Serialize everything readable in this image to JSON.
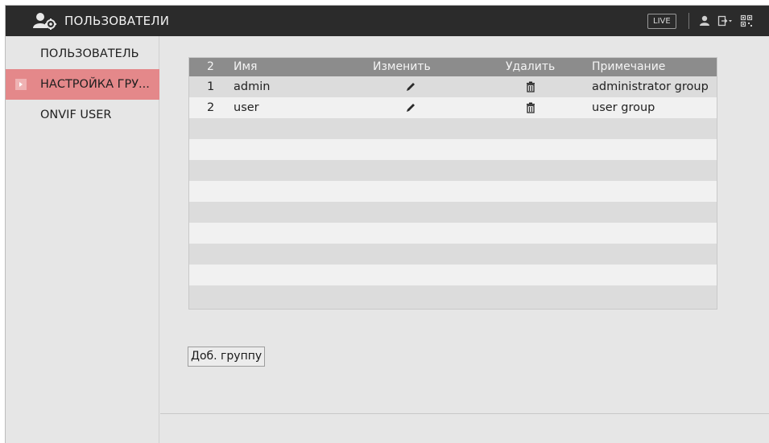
{
  "header": {
    "title": "ПОЛЬЗОВАТЕЛИ",
    "title_icon": "users-settings-icon",
    "live_label": "LIVE",
    "icons": [
      "user-icon",
      "logout-icon",
      "qr-code-icon"
    ]
  },
  "sidebar": {
    "items": [
      {
        "label": "ПОЛЬЗОВАТЕЛЬ",
        "active": false
      },
      {
        "label": "НАСТРОЙКА ГРУ...",
        "active": true
      },
      {
        "label": "ONVIF USER",
        "active": false
      }
    ]
  },
  "table": {
    "headers": {
      "num": "2",
      "name": "Имя",
      "edit": "Изменить",
      "delete": "Удалить",
      "note": "Примечание"
    },
    "rows": [
      {
        "num": "1",
        "name": "admin",
        "note": "administrator group"
      },
      {
        "num": "2",
        "name": "user",
        "note": "user group"
      }
    ],
    "edit_icon": "pencil-icon",
    "delete_icon": "trash-icon"
  },
  "actions": {
    "add_group_label": "Доб. группу"
  },
  "colors": {
    "topbar": "#2b2b2b",
    "active_item": "#e4888a",
    "table_header": "#8c8c8c",
    "background": "#e6e6e6"
  }
}
